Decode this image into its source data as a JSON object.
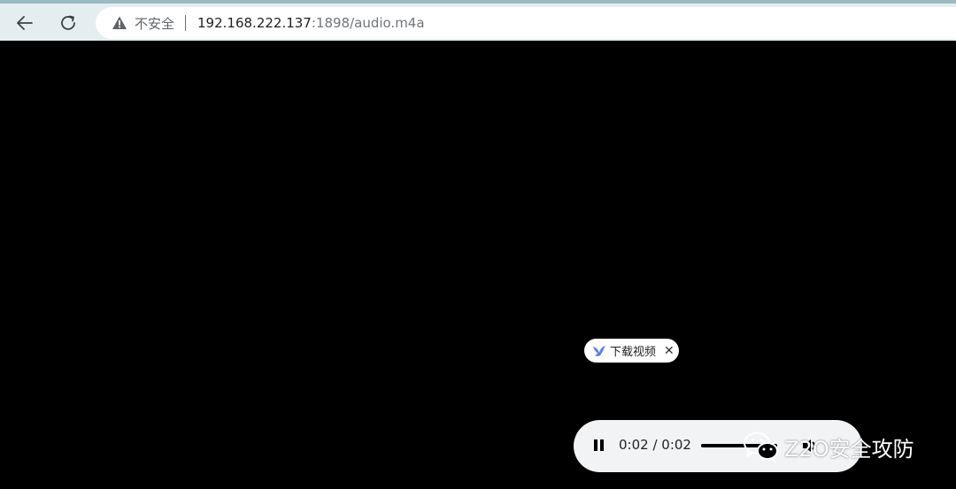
{
  "browser": {
    "security_label": "不安全",
    "url_host": "192.168.222.137",
    "url_rest": ":1898/audio.m4a"
  },
  "download_pill": {
    "label": "下载视频"
  },
  "player": {
    "time": "0:02 / 0:02",
    "progress_fraction": 1.0,
    "state": "pause-icon"
  },
  "watermark": {
    "text": "Z2O安全攻防"
  },
  "colors": {
    "toolbar_bg": "#e4eef0",
    "toolbar_border": "#9bbac1",
    "player_bg": "#f1f3f4",
    "page_bg": "#000000"
  }
}
